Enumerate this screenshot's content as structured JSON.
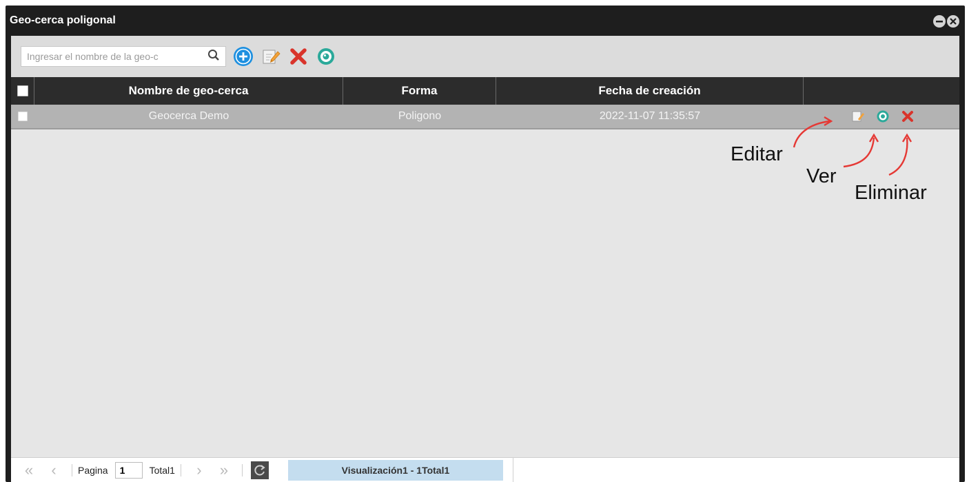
{
  "window": {
    "title": "Geo-cerca poligonal",
    "minimize_icon": "minus-circle-icon",
    "close_icon": "close-circle-icon"
  },
  "toolbar": {
    "search_placeholder": "Ingresar el nombre de la geo-c",
    "search_icon": "search-icon",
    "add_icon": "add-circle-icon",
    "edit_icon": "edit-icon",
    "delete_icon": "delete-x-icon",
    "view_icon": "eye-icon"
  },
  "grid": {
    "columns": [
      "Nombre de geo-cerca",
      "Forma",
      "Fecha de creación",
      ""
    ],
    "rows": [
      {
        "name": "Geocerca Demo",
        "shape": "Poligono",
        "created": "2022-11-07 11:35:57"
      }
    ]
  },
  "annotations": {
    "edit": "Editar",
    "view": "Ver",
    "delete": "Eliminar"
  },
  "pager": {
    "page_label": "Pagina",
    "page_value": "1",
    "total_label": "Total1",
    "display_text": "Visualización1 - 1Total1"
  },
  "colors": {
    "accent_blue": "#1e90e0",
    "delete_red": "#d9342b",
    "view_teal": "#2ba99a",
    "arrow_red": "#e53935"
  }
}
